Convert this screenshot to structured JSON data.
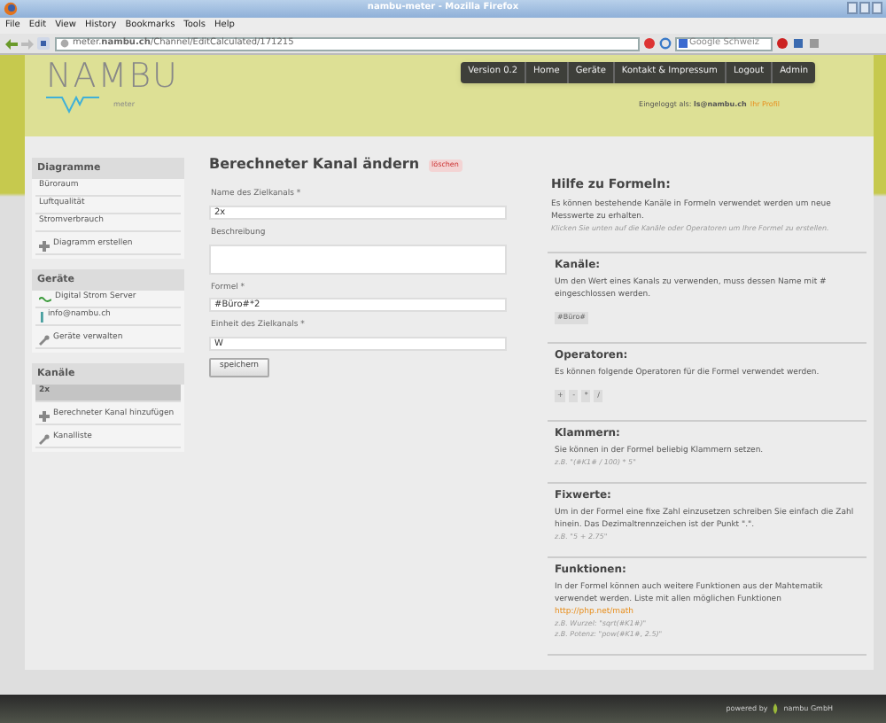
{
  "window": {
    "title": "nambu-meter - Mozilla Firefox"
  },
  "menu": [
    "File",
    "Edit",
    "View",
    "History",
    "Bookmarks",
    "Tools",
    "Help"
  ],
  "address": {
    "url": "meter.**nambu.ch**/Channel/EditCalculated/171215"
  },
  "search": {
    "placeholder": "Google Schweiz"
  },
  "header": {
    "logo": "NAMBU",
    "logo_sub": "meter",
    "nav": [
      {
        "label": "Version 0.2"
      },
      {
        "label": "Home"
      },
      {
        "label": "Geräte"
      },
      {
        "label": "Kontakt & Impressum"
      },
      {
        "label": "Logout"
      },
      {
        "label": "Admin"
      }
    ],
    "login": "Eingeloggt als: **ls@nambu.ch**",
    "profile_link": "Ihr Profil"
  },
  "sidebar": [
    {
      "title": "Diagramme",
      "items": [
        {
          "label": "Büroraum",
          "kind": "link",
          "selected": false
        },
        {
          "label": "Luftqualität",
          "kind": "link",
          "selected": false
        },
        {
          "label": "Stromverbrauch",
          "kind": "link",
          "selected": false
        },
        {
          "label": "Diagramm erstellen",
          "kind": "add",
          "selected": false
        }
      ]
    },
    {
      "title": "Geräte",
      "items": [
        {
          "label": "Digital Strom Server",
          "kind": "wave",
          "selected": false
        },
        {
          "label": "info@nambu.ch",
          "kind": "bar",
          "selected": false
        },
        {
          "label": "Geräte verwalten",
          "kind": "tools",
          "selected": false
        }
      ]
    },
    {
      "title": "Kanäle",
      "items": [
        {
          "label": "2x",
          "kind": "link",
          "selected": true
        },
        {
          "label": "Berechneter Kanal hinzufügen",
          "kind": "add",
          "selected": false
        },
        {
          "label": "Kanalliste",
          "kind": "tools",
          "selected": false
        }
      ]
    }
  ],
  "form": {
    "title": "Berechneter Kanal ändern",
    "delete": "löschen",
    "fields": [
      {
        "label": "Name des Zielkanals *",
        "value": "2x",
        "kind": "input"
      },
      {
        "label": "Beschreibung",
        "kind": "textarea"
      },
      {
        "label": "Formel *",
        "value": "#Büro#*2",
        "kind": "input"
      },
      {
        "label": "Einheit des Zielkanals *",
        "value": "W",
        "kind": "input"
      }
    ],
    "button": "speichern"
  },
  "help": {
    "title": "Hilfe zu Formeln:",
    "blocks": [
      {
        "kind": "text",
        "text": "Es können bestehende Kanäle in Formeln verwendet werden um neue Messwerte zu erhalten."
      },
      {
        "kind": "note",
        "text": "Klicken Sie unten auf die Kanäle oder Operatoren um Ihre Formel zu erstellen."
      }
    ],
    "sections": [
      {
        "title": "Kanäle:",
        "blocks": [
          {
            "kind": "text",
            "text": "Um den Wert eines Kanals zu verwenden, muss dessen Name mit # eingeschlossen werden."
          },
          {
            "kind": "chips",
            "items": [
              "#Büro#"
            ]
          }
        ]
      },
      {
        "title": "Operatoren:",
        "blocks": [
          {
            "kind": "text",
            "text": "Es können folgende Operatoren für die Formel verwendet werden."
          },
          {
            "kind": "chips",
            "items": [
              "+",
              "-",
              "*",
              "/"
            ]
          }
        ]
      },
      {
        "title": "Klammern:",
        "blocks": [
          {
            "kind": "text",
            "text": "Sie können in der Formel beliebig Klammern setzen."
          },
          {
            "kind": "note",
            "text": "z.B. \"(#K1# / 100) * 5\""
          }
        ]
      },
      {
        "title": "Fixwerte:",
        "blocks": [
          {
            "kind": "text",
            "text": "Um in der Formel eine fixe Zahl einzusetzen schreiben Sie einfach die Zahl hinein. Das Dezimaltrennzeichen ist der Punkt \".\"."
          },
          {
            "kind": "note",
            "text": "z.B. \"5 + 2.75\""
          }
        ]
      },
      {
        "title": "Funktionen:",
        "blocks": [
          {
            "kind": "text",
            "text": "In der Formel können auch weitere Funktionen aus der Mahtematik verwendet werden. Liste mit allen möglichen Funktionen"
          },
          {
            "kind": "link",
            "text": "http://php.net/math"
          },
          {
            "kind": "note",
            "text": "z.B. Wurzel: \"sqrt(#K1#)\""
          },
          {
            "kind": "note",
            "text": "z.B. Potenz: \"pow(#K1#, 2.5)\""
          }
        ]
      }
    ]
  },
  "footer": {
    "powered": "powered by",
    "company": "nambu GmbH"
  }
}
